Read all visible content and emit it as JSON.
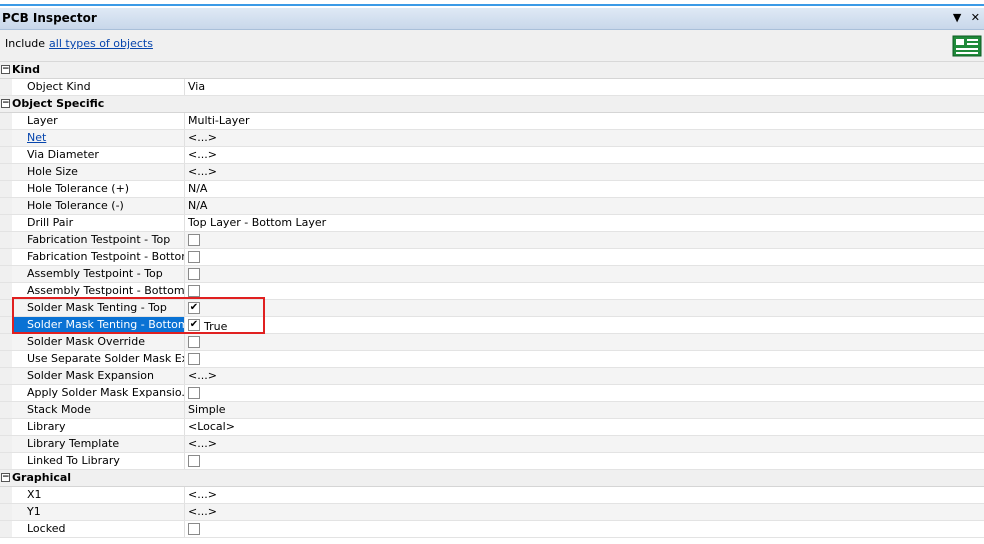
{
  "app": {
    "title": "PCB Inspector",
    "pin_glyph": "▼",
    "close_glyph": "✕"
  },
  "include": {
    "prefix": "Include",
    "link": "all types of objects"
  },
  "colors": {
    "accent": "#3b9ae6",
    "selection": "#0a72d4",
    "highlight": "#e02020",
    "link": "#0645ad"
  },
  "categories": {
    "kind": {
      "label": "Kind",
      "rows": [
        {
          "name": "Object Kind",
          "value": "Via"
        }
      ]
    },
    "object_specific": {
      "label": "Object Specific",
      "rows": [
        {
          "name": "Layer",
          "value": "Multi-Layer"
        },
        {
          "name": "Net",
          "value": "<...>"
        },
        {
          "name": "Via Diameter",
          "value": "<...>"
        },
        {
          "name": "Hole Size",
          "value": "<...>"
        },
        {
          "name": "Hole Tolerance (+)",
          "value": "N/A"
        },
        {
          "name": "Hole Tolerance (-)",
          "value": "N/A"
        },
        {
          "name": "Drill Pair",
          "value": "Top Layer - Bottom Layer"
        },
        {
          "name": "Fabrication Testpoint - Top",
          "checked": false
        },
        {
          "name": "Fabrication Testpoint - Bottom",
          "checked": false
        },
        {
          "name": "Assembly Testpoint - Top",
          "checked": false
        },
        {
          "name": "Assembly Testpoint - Bottom",
          "checked": false
        },
        {
          "name": "Solder Mask Tenting - Top",
          "checked": true
        },
        {
          "name": "Solder Mask Tenting - Bottom",
          "checked": true,
          "value_text": "True"
        },
        {
          "name": "Solder Mask Override",
          "checked": false
        },
        {
          "name": "Use Separate Solder Mask Ex...",
          "checked": false
        },
        {
          "name": "Solder Mask Expansion",
          "value": "<...>"
        },
        {
          "name": "Apply Solder Mask Expansio...",
          "checked": false
        },
        {
          "name": "Stack Mode",
          "value": "Simple"
        },
        {
          "name": "Library",
          "value": "<Local>"
        },
        {
          "name": "Library Template",
          "value": "<...>"
        },
        {
          "name": "Linked To Library",
          "checked": false
        }
      ]
    },
    "graphical": {
      "label": "Graphical",
      "rows": [
        {
          "name": "X1",
          "value": "<...>"
        },
        {
          "name": "Y1",
          "value": "<...>"
        },
        {
          "name": "Locked",
          "checked": false
        }
      ]
    }
  },
  "check_glyph": "✔",
  "collapse_glyph": "−"
}
